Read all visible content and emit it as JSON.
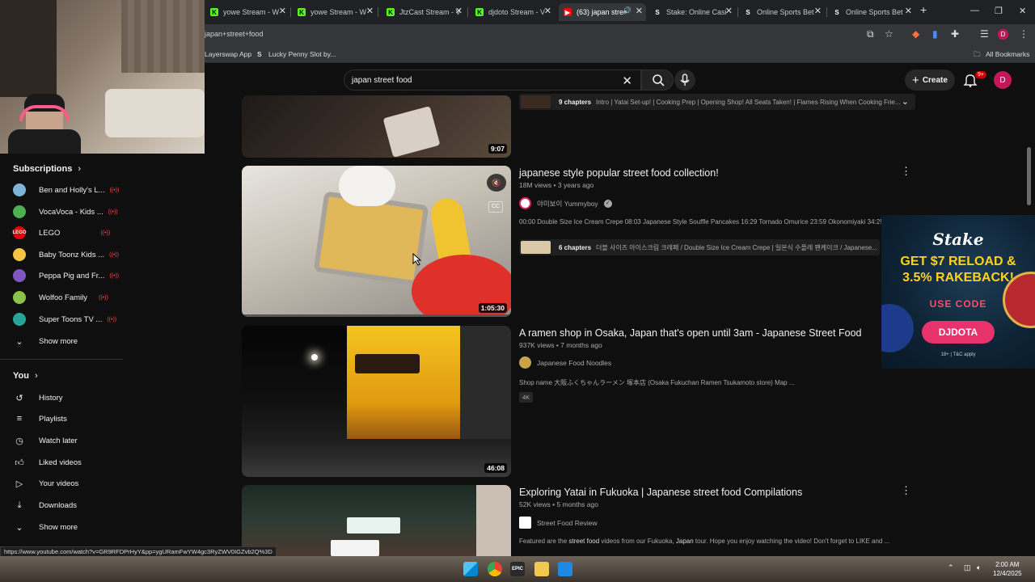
{
  "browser": {
    "tabs": [
      {
        "label": "yowe Stream - W",
        "icon": "kick-icon",
        "color": "#53fc18"
      },
      {
        "label": "yowe Stream - W",
        "icon": "kick-icon",
        "color": "#53fc18"
      },
      {
        "label": "JtzCast Stream - V",
        "icon": "kick-icon",
        "color": "#53fc18"
      },
      {
        "label": "djdoto Stream - V",
        "icon": "kick-icon",
        "color": "#53fc18"
      },
      {
        "label": "(63) japan stre",
        "icon": "youtube-icon",
        "color": "#ff0000"
      },
      {
        "label": "Stake: Online Casi",
        "icon": "stake-icon",
        "color": "#ffffff"
      },
      {
        "label": "Online Sports Bet",
        "icon": "stake-icon",
        "color": "#ffffff"
      },
      {
        "label": "Online Sports Bet",
        "icon": "stake-icon",
        "color": "#ffffff"
      }
    ],
    "address": "japan+street+food",
    "bookmarks": [
      {
        "label": "Layerswap App"
      },
      {
        "label": "Lucky Penny Slot by..."
      }
    ],
    "all_bookmarks": "All Bookmarks",
    "status_url": "https://www.youtube.com/watch?v=GR9RFDPrHyY&pp=ygURamFwYW4gc3RyZWV0IGZvb2Q%3D"
  },
  "masthead": {
    "search_query": "japan street food",
    "create_label": "Create",
    "notif_count": "9+",
    "avatar_letter": "D"
  },
  "sidebar": {
    "subscriptions_heading": "Subscriptions",
    "subscriptions": [
      {
        "label": "Ben and Holly's L...",
        "color": "#7fb3d5"
      },
      {
        "label": "VocaVoca - Kids ...",
        "color": "#4caf50"
      },
      {
        "label": "LEGO",
        "color": "#e3000b"
      },
      {
        "label": "Baby Toonz Kids ...",
        "color": "#f4c542"
      },
      {
        "label": "Peppa Pig and Fr...",
        "color": "#7e57c2"
      },
      {
        "label": "Wolfoo Family",
        "color": "#8bc34a"
      },
      {
        "label": "Super Toons TV ...",
        "color": "#26a69a"
      }
    ],
    "show_more": "Show more",
    "you_heading": "You",
    "you_items": [
      {
        "label": "History",
        "icon": "history-icon"
      },
      {
        "label": "Playlists",
        "icon": "playlists-icon"
      },
      {
        "label": "Watch later",
        "icon": "watch-later-icon"
      },
      {
        "label": "Liked videos",
        "icon": "like-icon"
      },
      {
        "label": "Your videos",
        "icon": "your-videos-icon"
      },
      {
        "label": "Downloads",
        "icon": "download-icon"
      }
    ],
    "show_more_2": "Show more"
  },
  "results": [
    {
      "duration": "9:07",
      "chapters_count": "9 chapters",
      "chapters_text": "Intro | Yatai Set-up! | Cooking Prep | Opening Shop! All Seats Taken! | Flames Rising When Cooking Frie..."
    },
    {
      "title": "japanese style popular street food collection!",
      "views": "18M views",
      "age": "3 years ago",
      "channel": "야미보이 Yummyboy",
      "verified": true,
      "description": "00:00 Double Size Ice Cream Crepe 08:03 Japanese Style Souffle Pancakes 16:29 Tornado Omurice 23:59 Okonomiyaki 34:25 S",
      "chapters_count": "6 chapters",
      "chapters_text": "더블 사이즈 아이스크림 크레페 / Double Size Ice Cream Crepe | 일본식 수플레 팬케이크 / Japanese...",
      "duration": "1:05:30"
    },
    {
      "title": "A ramen shop in Osaka, Japan that's open until 3am - Japanese Street Food",
      "views": "937K views",
      "age": "7 months ago",
      "channel": "Japanese Food Noodles",
      "description": "Shop name 大阪ふくちゃんラーメン 塚本店 (Osaka Fukuchan Ramen Tsukamoto store) Map ...",
      "badge": "4K",
      "duration": "46:08"
    },
    {
      "title": "Exploring Yatai in Fukuoka | Japanese street food Compilations",
      "views": "52K views",
      "age": "5 months ago",
      "channel": "Street Food Review",
      "description_pre": "Featured are the ",
      "description_b1": "street food",
      "description_mid": " videos from our Fukuoka, ",
      "description_b2": "Japan",
      "description_post": " tour. Hope you enjoy watching the video! Don't forget to LIKE and ..."
    }
  ],
  "ad": {
    "brand": "Stake",
    "headline": "GET $7 RELOAD & 3.5% RAKEBACK!",
    "use_code": "USE CODE",
    "code": "DJDOTA",
    "terms": "18+ | T&C apply"
  },
  "taskbar": {
    "time": "2:00 AM",
    "date": "12/4/2025"
  }
}
